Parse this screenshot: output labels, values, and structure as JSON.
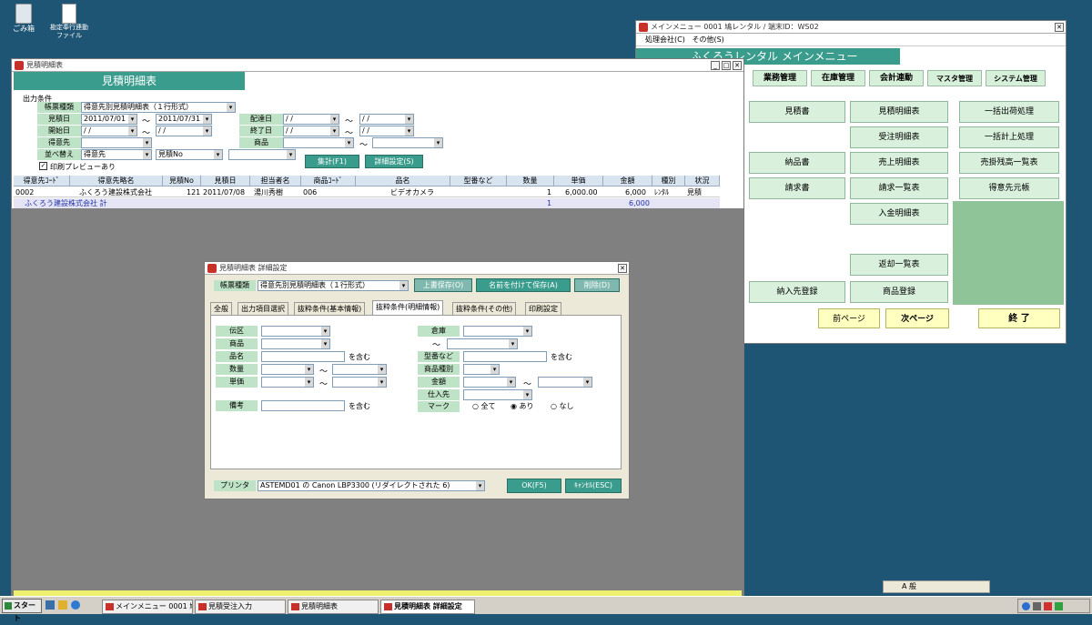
{
  "desktop": {
    "icons": [
      {
        "label": "ごみ箱"
      },
      {
        "label": "勘定奉行連動\nファイル"
      }
    ]
  },
  "menu_window": {
    "title": "メインメニュー 0001 鳩レンタル / 端末ID：WS02",
    "menubar": [
      "処理会社(C)",
      "その他(S)"
    ],
    "header": "ふくろうレンタル メインメニュー",
    "tabs": [
      "業務管理",
      "在庫管理",
      "会計連動",
      "マスタ管理",
      "システム管理"
    ],
    "buttons": [
      "見積書",
      "見積明細表",
      "一括出荷処理",
      "受注明細表",
      "一括計上処理",
      "納品書",
      "売上明細表",
      "売掛残高一覧表",
      "請求書",
      "請求一覧表",
      "得意先元帳",
      "入金明細表",
      "返却一覧表",
      "納入先登録",
      "商品登録"
    ],
    "nav": {
      "prev": "前ページ",
      "next": "次ページ",
      "end": "終 了"
    }
  },
  "report_window": {
    "title": "見積明細表",
    "heading": "見積明細表",
    "section": "出力条件",
    "labels": {
      "type": "帳票種類",
      "date": "見積日",
      "start": "開始日",
      "customer": "得意先",
      "sort": "並べ替え",
      "delivery": "配達日",
      "end": "終了日",
      "product": "商品"
    },
    "values": {
      "type": "得意先別見積明細表（１行形式）",
      "date_from": "2011/07/01",
      "date_to": "2011/07/31",
      "blank": "/ /",
      "sort1": "得意先",
      "sort2": "見積No"
    },
    "tilde": "～",
    "preview": "印刷プレビューあり",
    "buttons": {
      "sum": "集計(F1)",
      "detail": "詳細設定(S)"
    },
    "columns": [
      "得意先ｺｰﾄﾞ",
      "得意先略名",
      "見積No",
      "見積日",
      "担当者名",
      "商品ｺｰﾄﾞ",
      "品名",
      "型番など",
      "数量",
      "単価",
      "金額",
      "種別",
      "状況"
    ],
    "row": [
      "0002",
      "ふくろう建設株式会社",
      "121",
      "2011/07/08",
      "湯川秀樹",
      "006",
      "ビデオカメラ",
      "",
      "1",
      "6,000.00",
      "6,000",
      "ﾚﾝﾀﾙ",
      "見積"
    ],
    "total": {
      "label": "ふくろう建設株式会社 計",
      "qty": "1",
      "amount": "6,000"
    }
  },
  "dialog": {
    "title": "見積明細表 詳細設定",
    "type_label": "帳票種類",
    "type_value": "得意先別見積明細表（１行形式）",
    "buttons": {
      "overwrite": "上書保存(O)",
      "saveas": "名前を付けて保存(A)",
      "delete": "削除(D)",
      "ok": "OK(F5)",
      "cancel": "ｷｬﾝｾﾙ(ESC)"
    },
    "tabs": [
      "全般",
      "出力項目選択",
      "抜粋条件(基本情報)",
      "抜粋条件(明細情報)",
      "抜粋条件(その他)",
      "印刷設定"
    ],
    "fields": {
      "denku": "伝区",
      "product": "商品",
      "name": "品名",
      "qty": "数量",
      "price": "単価",
      "memo": "備考",
      "warehouse": "倉庫",
      "model": "型番など",
      "ptype": "商品種別",
      "amount": "金額",
      "supplier": "仕入先",
      "mark": "マーク"
    },
    "contains": "を含む",
    "tilde": "～",
    "radio": [
      "全て",
      "あり",
      "なし"
    ],
    "printer_label": "プリンタ",
    "printer_value": "ASTEMD01 の Canon LBP3300 (リダイレクトされた 6)"
  },
  "taskbar": {
    "start": "スタート",
    "tasks": [
      "メインメニュー 0001 鳩レ...",
      "見積受注入力",
      "見積明細表",
      "見積明細表 詳細設定"
    ]
  },
  "ime": {
    "text": "A 般"
  }
}
